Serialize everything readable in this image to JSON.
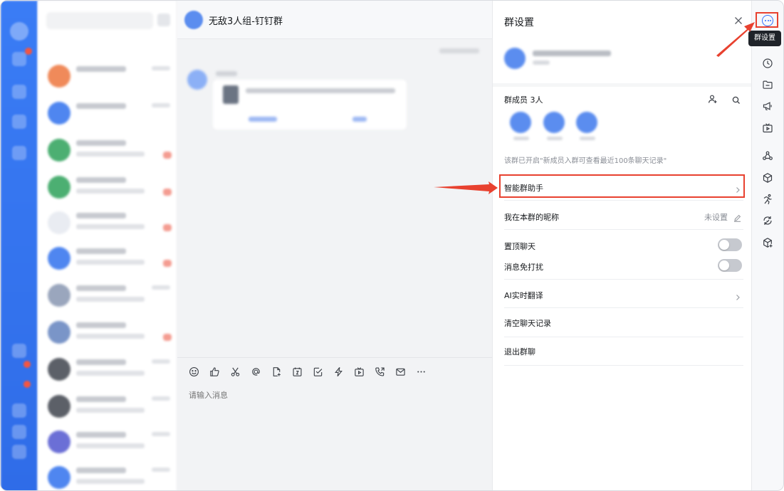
{
  "chat": {
    "title": "无敌3人组-钉钉群",
    "input_placeholder": "请输入消息",
    "toolbar_icons": [
      "emoji-icon",
      "thumbs-up-icon",
      "scissors-icon",
      "at-icon",
      "file-upload-icon",
      "calendar-icon",
      "task-check-icon",
      "lightning-icon",
      "live-icon",
      "phone-icon",
      "mail-icon",
      "more-icon"
    ]
  },
  "panel": {
    "title": "群设置",
    "members_label": "群成员 3人",
    "members_note": "该群已开启\"新成员入群可查看最近100条聊天记录\"",
    "rows": {
      "assistant": "智能群助手",
      "nickname": "我在本群的昵称",
      "nickname_value": "未设置",
      "pin": "置顶聊天",
      "mute": "消息免打扰",
      "translate": "AI实时翻译",
      "clear": "清空聊天记录",
      "quit": "退出群聊"
    },
    "toggles": {
      "pin": false,
      "mute": false
    }
  },
  "right_rail": {
    "tooltip": "群设置",
    "icons": [
      "more-icon",
      "clock-icon",
      "folder-icon",
      "megaphone-icon",
      "tv-icon",
      "network-icon",
      "cube-icon",
      "running-icon",
      "sync-icon",
      "add-app-icon"
    ]
  },
  "colors": {
    "accent": "#3370ff",
    "highlight": "#e8412f",
    "nav_rail": "#2f6ce8"
  }
}
